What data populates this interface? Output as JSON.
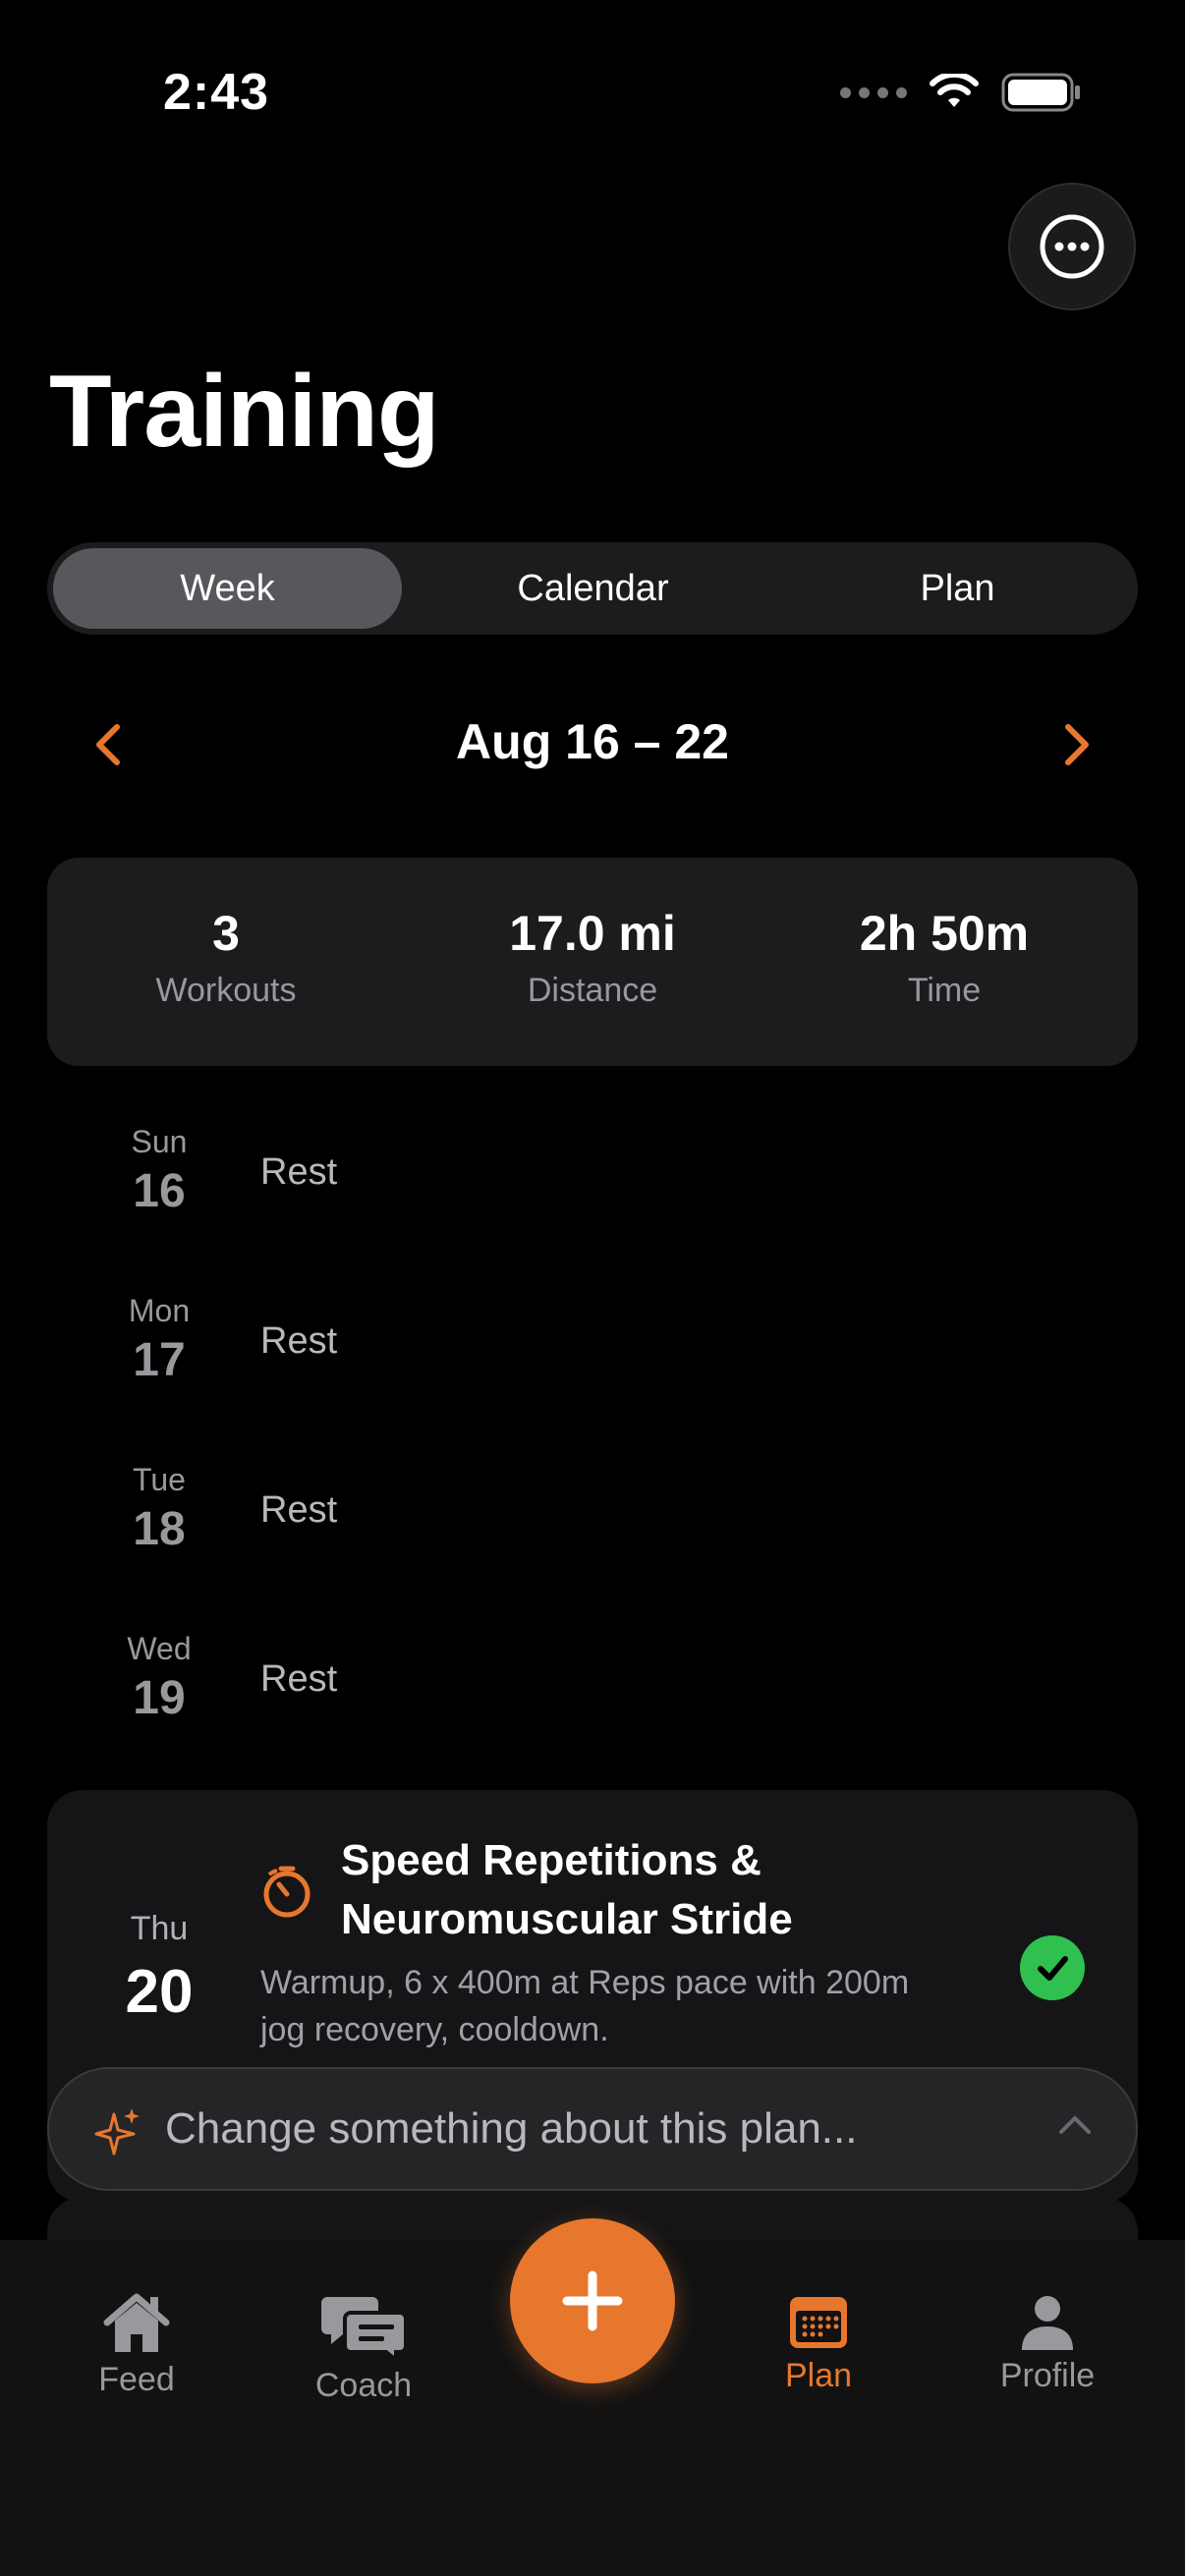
{
  "status_bar": {
    "time": "2:43"
  },
  "header": {
    "title": "Training",
    "more_icon": "ellipsis-circle-icon"
  },
  "segmented": {
    "options": [
      "Week",
      "Calendar",
      "Plan"
    ],
    "selected": "Week"
  },
  "week_nav": {
    "range": "Aug 16 – 22"
  },
  "summary": {
    "workouts": {
      "value": "3",
      "label": "Workouts"
    },
    "distance": {
      "value": "17.0 mi",
      "label": "Distance"
    },
    "time": {
      "value": "2h 50m",
      "label": "Time"
    }
  },
  "days": [
    {
      "name": "Sun",
      "num": "16",
      "status": "Rest"
    },
    {
      "name": "Mon",
      "num": "17",
      "status": "Rest"
    },
    {
      "name": "Tue",
      "num": "18",
      "status": "Rest"
    },
    {
      "name": "Wed",
      "num": "19",
      "status": "Rest"
    }
  ],
  "workout": {
    "day_name": "Thu",
    "day_num": "20",
    "title": "Speed Repetitions & Neuromuscular Stride",
    "description": "Warmup, 6 x 400m at Reps pace with 200m jog recovery, cooldown.",
    "completed": true
  },
  "change_bar": {
    "placeholder": "Change something about this plan..."
  },
  "tabs": [
    {
      "label": "Feed",
      "icon": "house-icon"
    },
    {
      "label": "Coach",
      "icon": "chat-bubbles-icon"
    },
    {
      "label": "Plan",
      "icon": "calendar-icon",
      "active": true
    },
    {
      "label": "Profile",
      "icon": "person-icon"
    }
  ],
  "colors": {
    "accent": "#e8772e",
    "success": "#30c04f",
    "card": "#1c1c1e"
  }
}
